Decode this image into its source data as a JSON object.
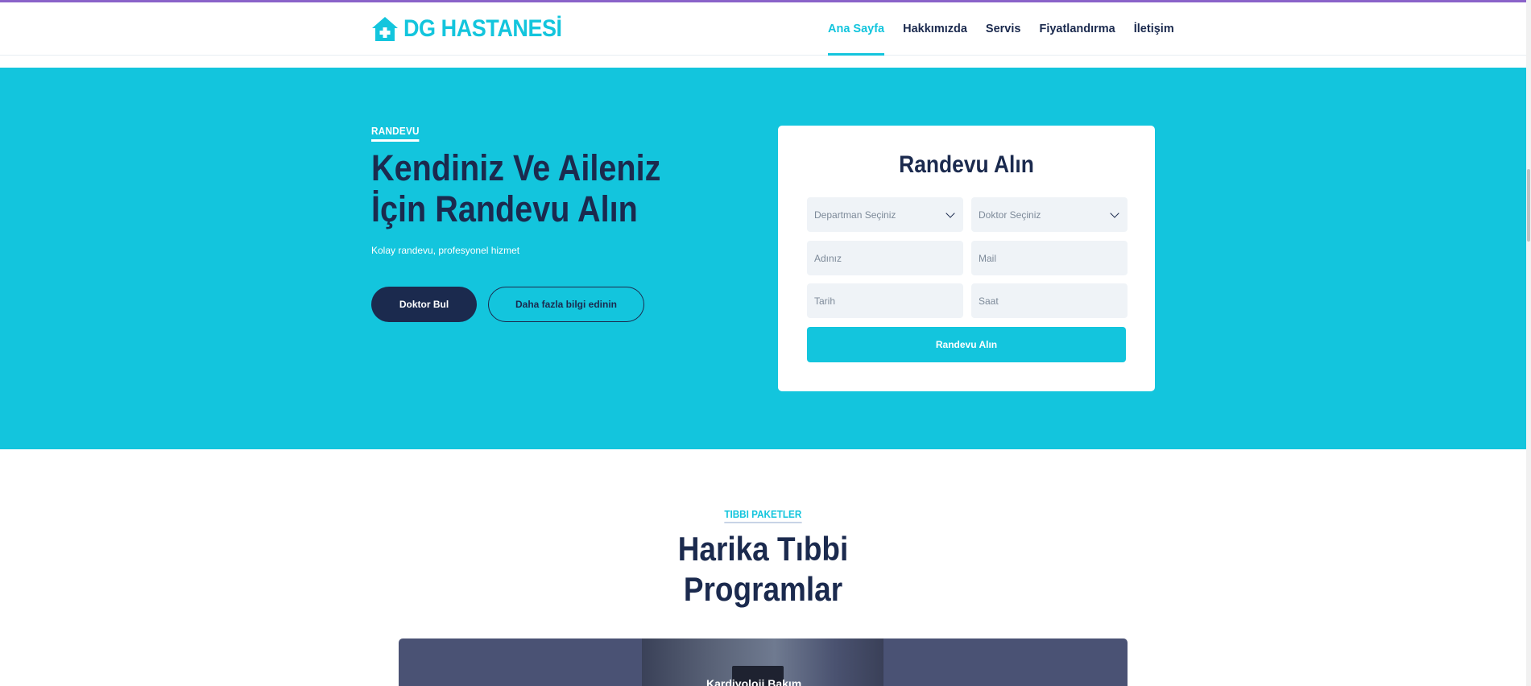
{
  "header": {
    "brand": "DG HASTANESİ",
    "brand_icon": "house-medical-icon",
    "nav": [
      {
        "label": "Ana Sayfa",
        "active": true
      },
      {
        "label": "Hakkımızda",
        "active": false
      },
      {
        "label": "Servis",
        "active": false
      },
      {
        "label": "Fiyatlandırma",
        "active": false
      },
      {
        "label": "İletişim",
        "active": false
      }
    ]
  },
  "hero": {
    "eyebrow": "RANDEVU",
    "title": "Kendiniz Ve Aileniz İçin Randevu Alın",
    "subtitle": "Kolay randevu, profesyonel hizmet",
    "primary_button": "Doktor Bul",
    "secondary_button": "Daha fazla bilgi edinin"
  },
  "form": {
    "title": "Randevu Alın",
    "department_select": "Departman Seçiniz",
    "doctor_select": "Doktor Seçiniz",
    "name_placeholder": "Adınız",
    "mail_placeholder": "Mail",
    "date_placeholder": "Tarih",
    "time_placeholder": "Saat",
    "submit_label": "Randevu Alın"
  },
  "packages": {
    "eyebrow": "TIBBI PAKETLER",
    "title_line1": "Harika Tıbbi",
    "title_line2": "Programlar",
    "card_label": "Kardiyoloji Bakım"
  },
  "colors": {
    "accent": "#13c5dd",
    "navy": "#1b2a4e",
    "field_bg": "#eff3f7"
  }
}
